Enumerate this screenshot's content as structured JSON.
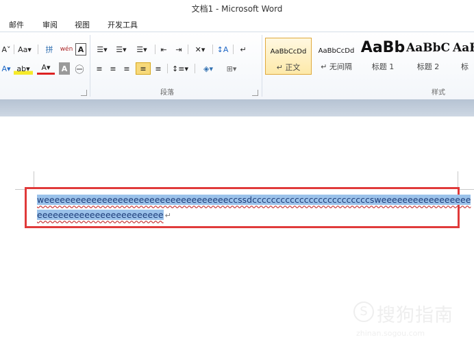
{
  "window": {
    "title": "文档1 - Microsoft Word"
  },
  "tabs": [
    "邮件",
    "审阅",
    "视图",
    "开发工具"
  ],
  "ribbon": {
    "font_group": {
      "row1": [
        "A˅",
        "Aa▾",
        "拼",
        "wén",
        "A"
      ],
      "row2": [
        "A▾",
        "ab▾",
        "A▾",
        "A",
        "㊀"
      ]
    },
    "paragraph_group": {
      "label": "段落",
      "row1": [
        "☰▾",
        "☰▾",
        "☰▾",
        "⇤",
        "⇥",
        "✕▾",
        "↕A",
        "↵"
      ],
      "row2": [
        "≡",
        "≡",
        "≡",
        "≡",
        "≡",
        "↕≡▾",
        "◈▾",
        "⊞▾"
      ]
    },
    "styles_group": {
      "label": "样式",
      "items": [
        {
          "sample": "AaBbCcDd",
          "label": "↵ 正文",
          "selected": true
        },
        {
          "sample": "AaBbCcDd",
          "label": "↵ 无间隔",
          "selected": false
        },
        {
          "sample": "AaBb",
          "label": "标题 1",
          "selected": false
        },
        {
          "sample": "AaBbC",
          "label": "标题 2",
          "selected": false
        },
        {
          "sample": "AaB",
          "label": "标",
          "selected": false
        }
      ]
    }
  },
  "document": {
    "line1": "weeeeeeeeeeeeeeeeeeeeeeeeeeeeeeeeeeeccssdcccccccccccccccccccccccccsweeeeeeeeeeeeeeeee",
    "line2": "eeeeeeeeeeeeeeeeeeeeeeee",
    "paragraph_mark": "↵"
  },
  "watermark": {
    "main": "搜狗指南",
    "sub": "zhinan.sogou.com"
  }
}
